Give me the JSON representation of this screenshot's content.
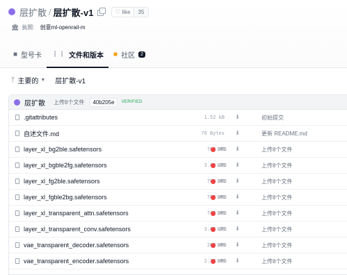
{
  "header": {
    "org_name": "层扩散",
    "separator": "/",
    "repo_name": "层扩散-v1",
    "like_icon": "♡",
    "like_label": "like",
    "like_count": "35",
    "license_label": "执照:",
    "license_value": "创意ml-openrail-m"
  },
  "tabs": [
    {
      "icon": "cube-icon",
      "label": "型号卡",
      "active": false
    },
    {
      "icon": "files-icon",
      "label": "文件和版本",
      "active": true
    },
    {
      "icon": "chat-icon",
      "label": "社区",
      "badge": "2",
      "active": false
    }
  ],
  "branch": {
    "name": "主要的",
    "path": "层扩散-v1"
  },
  "commit": {
    "author": "层扩散",
    "message": "上传8个文件",
    "hash": "40b205e",
    "status": "VERIFIED"
  },
  "files": [
    {
      "name": ".gitattributes",
      "size": "1.52 kB",
      "lfs": "",
      "message": "初始提交"
    },
    {
      "name": "自述文件.md",
      "size": "70 Bytes",
      "lfs": "",
      "message": "更新 README.md"
    },
    {
      "name": "layer_xl_bg2ble.safetensors",
      "size": "702 MB",
      "lfs": "LFS",
      "message": "上传8个文件"
    },
    {
      "name": "layer_xl_bgble2fg.safetensors",
      "size": "3.62 GB",
      "lfs": "LFS",
      "message": "上传8个文件"
    },
    {
      "name": "layer_xl_fg2ble.safetensors",
      "size": "702 MB",
      "lfs": "LFS",
      "message": "上传8个文件"
    },
    {
      "name": "layer_xl_fgble2bg.safetensors",
      "size": "702 MB",
      "lfs": "LFS",
      "message": "上传8个文件"
    },
    {
      "name": "layer_xl_transparent_attn.safetensors",
      "size": "743 MB",
      "lfs": "LFS",
      "message": "上传8个文件"
    },
    {
      "name": "layer_xl_transparent_conv.safetensors",
      "size": "3.62 GB",
      "lfs": "LFS",
      "message": "上传8个文件"
    },
    {
      "name": "vae_transparent_decoder.safetensors",
      "size": "208 MB",
      "lfs": "LFS",
      "message": "上传8个文件"
    },
    {
      "name": "vae_transparent_encoder.safetensors",
      "size": "2.37 MB",
      "lfs": "LFS",
      "message": "上传8个文件"
    }
  ],
  "colors": {
    "accent_purple": "#8b6fe8",
    "lfs_red": "#ef4444",
    "verified_green": "#16a34a"
  }
}
